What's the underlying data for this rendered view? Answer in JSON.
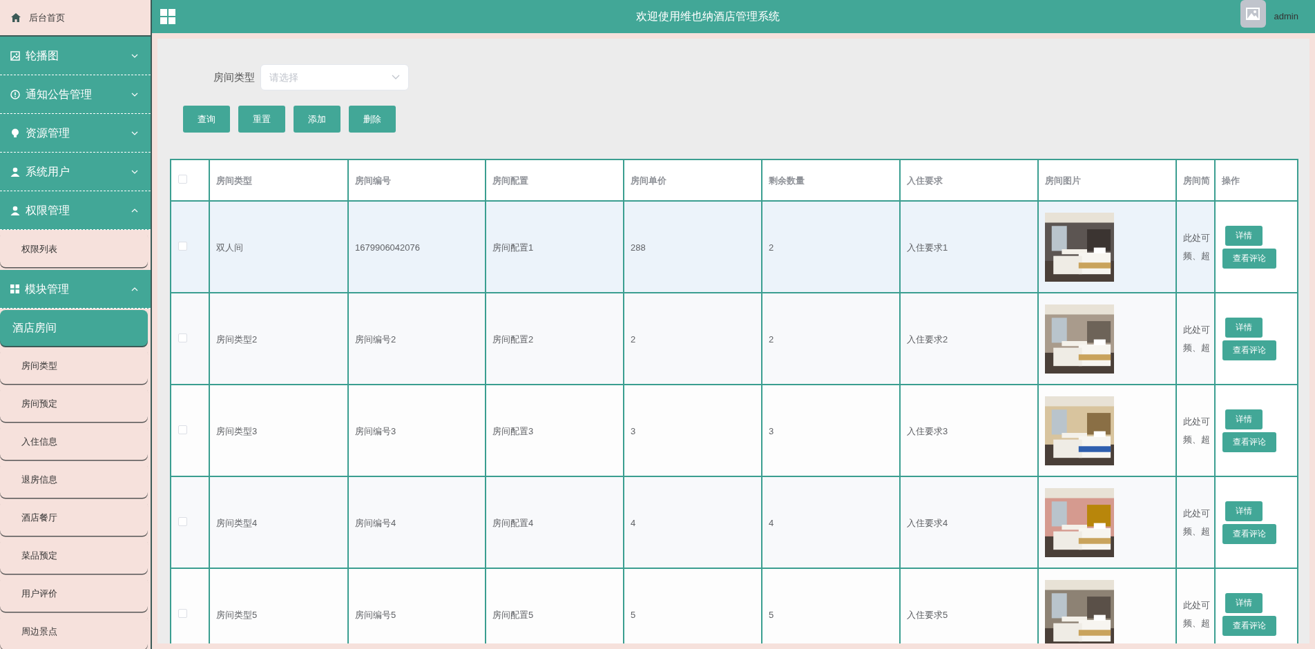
{
  "sidebar": {
    "home": {
      "label": "后台首页"
    },
    "menus": [
      {
        "label": "轮播图",
        "expanded": false
      },
      {
        "label": "通知公告管理",
        "expanded": false
      },
      {
        "label": "资源管理",
        "expanded": false
      },
      {
        "label": "系统用户",
        "expanded": false
      },
      {
        "label": "权限管理",
        "expanded": true,
        "children": [
          {
            "label": "权限列表",
            "selected": false
          }
        ]
      },
      {
        "label": "模块管理",
        "expanded": true,
        "children": [
          {
            "label": "酒店房间",
            "selected": true
          },
          {
            "label": "房间类型",
            "selected": false
          },
          {
            "label": "房间预定",
            "selected": false
          },
          {
            "label": "入住信息",
            "selected": false
          },
          {
            "label": "退房信息",
            "selected": false
          },
          {
            "label": "酒店餐厅",
            "selected": false
          },
          {
            "label": "菜品预定",
            "selected": false
          },
          {
            "label": "用户评价",
            "selected": false
          },
          {
            "label": "周边景点",
            "selected": false
          }
        ]
      }
    ]
  },
  "header": {
    "title": "欢迎使用维也纳酒店管理系统",
    "user": "admin"
  },
  "filter": {
    "label": "房间类型",
    "placeholder": "请选择"
  },
  "toolbar": [
    "查询",
    "重置",
    "添加",
    "删除"
  ],
  "table": {
    "header_checked": false,
    "columns": [
      "房间类型",
      "房间编号",
      "房间配置",
      "房间单价",
      "剩余数量",
      "入住要求",
      "房间图片",
      "房间简",
      "操作"
    ],
    "rows": [
      {
        "checked": false,
        "highlighted": true,
        "cells": [
          "双人间",
          "1679906042076",
          "房间配置1",
          "288",
          "2",
          "入住要求1"
        ],
        "intro": [
          "此处可",
          "频、超"
        ],
        "actions": [
          "详情",
          "查看评论"
        ]
      },
      {
        "checked": false,
        "highlighted": false,
        "cells": [
          "房间类型2",
          "房间编号2",
          "房间配置2",
          "2",
          "2",
          "入住要求2"
        ],
        "intro": [
          "此处可",
          "频、超"
        ],
        "actions": [
          "详情",
          "查看评论"
        ]
      },
      {
        "checked": false,
        "highlighted": false,
        "cells": [
          "房间类型3",
          "房间编号3",
          "房间配置3",
          "3",
          "3",
          "入住要求3"
        ],
        "intro": [
          "此处可",
          "频、超"
        ],
        "actions": [
          "详情",
          "查看评论"
        ]
      },
      {
        "checked": false,
        "highlighted": false,
        "cells": [
          "房间类型4",
          "房间编号4",
          "房间配置4",
          "4",
          "4",
          "入住要求4"
        ],
        "intro": [
          "此处可",
          "频、超"
        ],
        "actions": [
          "详情",
          "查看评论"
        ]
      },
      {
        "checked": false,
        "highlighted": false,
        "cells": [
          "房间类型5",
          "房间编号5",
          "房间配置5",
          "5",
          "5",
          "入住要求5"
        ],
        "intro": [
          "此处可",
          "频、超"
        ],
        "actions": [
          "详情",
          "查看评论"
        ]
      }
    ]
  }
}
